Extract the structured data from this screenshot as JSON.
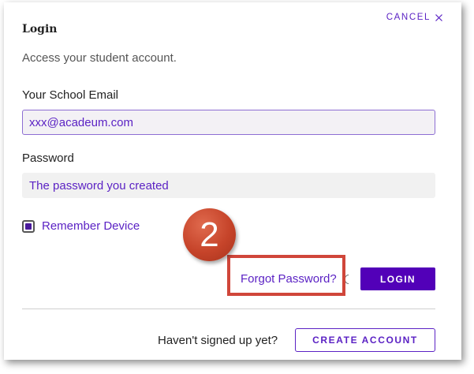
{
  "dialog": {
    "title": "Login",
    "cancel_label": "CANCEL",
    "subtitle": "Access your student account."
  },
  "email": {
    "label": "Your School Email",
    "value": "xxx@acadeum.com"
  },
  "password": {
    "label": "Password",
    "placeholder": "The password you created"
  },
  "remember": {
    "label": "Remember Device",
    "checked": true
  },
  "annotation": {
    "step_number": "2"
  },
  "actions": {
    "forgot_label": "Forgot Password?",
    "login_label": "LOGIN"
  },
  "signup": {
    "prompt": "Haven't signed up yet?",
    "create_label": "CREATE ACCOUNT"
  },
  "colors": {
    "accent": "#5b22c4",
    "login_button": "#5200b8",
    "annotation": "#d0463a"
  },
  "icons": {
    "cancel": "close-icon",
    "checkbox": "checkbox-checked-icon"
  }
}
